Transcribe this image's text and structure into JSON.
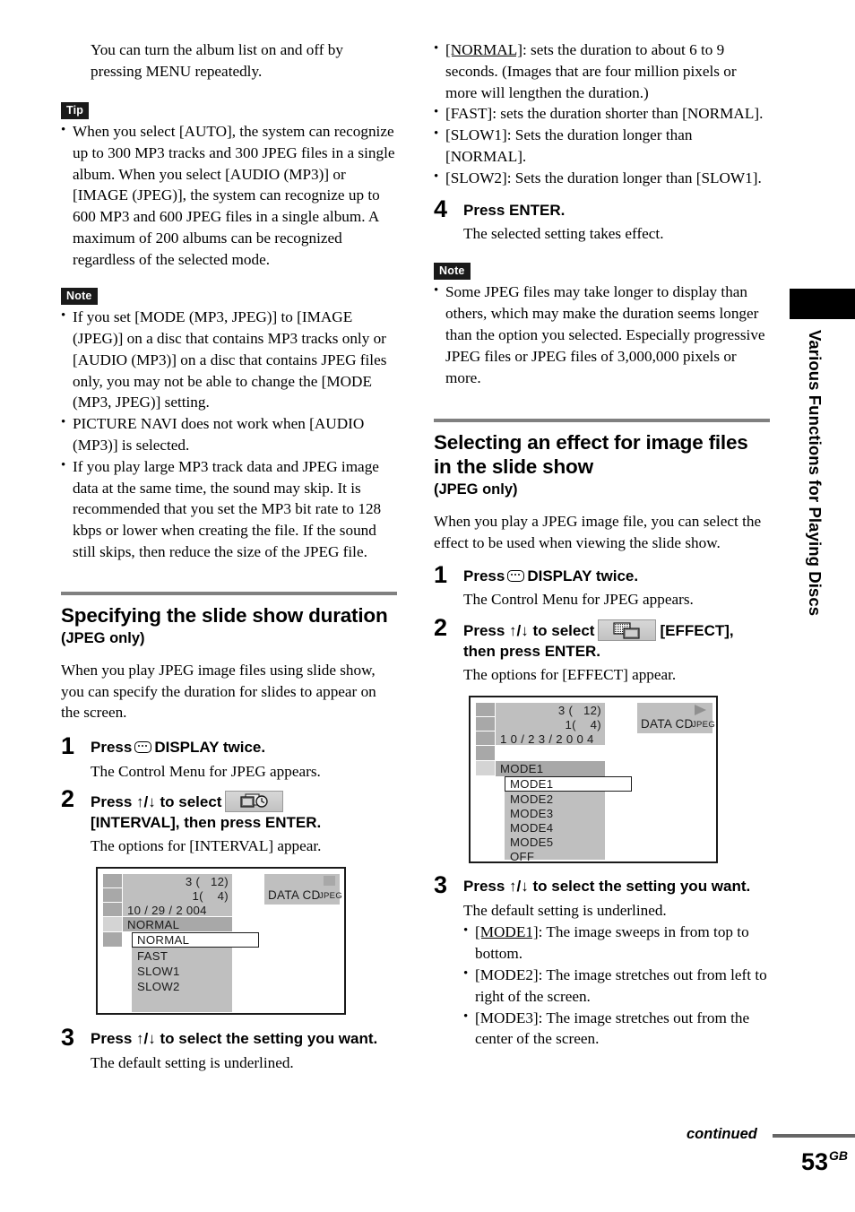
{
  "page": {
    "number": "53",
    "number_suffix": "GB",
    "continued_label": "continued",
    "side_tab_label": "Various Functions for Playing Discs"
  },
  "left_column": {
    "intro_paragraph": "You can turn the album list on and off by pressing MENU repeatedly.",
    "tip": {
      "badge": "Tip",
      "items": [
        "When you select [AUTO], the system can recognize up to 300 MP3 tracks and 300 JPEG files in a single album. When you select [AUDIO (MP3)] or [IMAGE (JPEG)], the system can recognize up to 600 MP3 and 600 JPEG files in a single album. A maximum of 200 albums can be recognized regardless of the selected mode."
      ]
    },
    "note": {
      "badge": "Note",
      "items": [
        "If you set [MODE (MP3, JPEG)] to [IMAGE (JPEG)] on a disc that contains MP3 tracks only or [AUDIO (MP3)] on a disc that contains JPEG files only, you may not be able to change the [MODE (MP3, JPEG)] setting.",
        "PICTURE NAVI does not work when [AUDIO (MP3)] is selected.",
        "If you play large MP3 track data and JPEG image data at the same time, the sound may skip. It is recommended that you set the MP3 bit rate to 128 kbps or lower when creating the file. If the sound still skips, then reduce the size of the JPEG file."
      ]
    },
    "section": {
      "title": "Specifying the slide show duration",
      "subtitle": "(JPEG only)",
      "intro": "When you play JPEG image files using slide show, you can specify the duration for slides to appear on the screen.",
      "steps": [
        {
          "number": "1",
          "heading_pre": "Press",
          "heading_post": "DISPLAY twice.",
          "icon": "display-icon",
          "body": "The Control Menu for JPEG appears."
        },
        {
          "number": "2",
          "heading_pre": "Press ↑/↓ to select",
          "heading_post": "[INTERVAL], then press ENTER.",
          "icon": "interval-icon",
          "body": "The options for [INTERVAL] appear."
        },
        {
          "number": "3",
          "heading": "Press ↑/↓ to select the setting you want.",
          "body": "The default setting is underlined."
        }
      ]
    },
    "tv_screen": {
      "track_line": "3 (   12)",
      "chapter_line": "1(    4)",
      "date_line": "10 / 29 / 2 004",
      "selected_value": "NORMAL",
      "disc_label": "DATA CD",
      "disc_format": "JPEG",
      "options": [
        "NORMAL",
        "FAST",
        "SLOW1",
        "SLOW2"
      ],
      "highlighted_option": "NORMAL"
    }
  },
  "right_column": {
    "interval_options": [
      {
        "name": "[NORMAL]",
        "underlined": true,
        "desc": ": sets the duration to about 6 to 9 seconds. (Images that are four million pixels or more will lengthen the duration.)"
      },
      {
        "name": "[FAST]",
        "underlined": false,
        "desc": ": sets the duration shorter than [NORMAL]."
      },
      {
        "name": "[SLOW1]",
        "underlined": false,
        "desc": ": Sets the duration longer than [NORMAL]."
      },
      {
        "name": "[SLOW2]",
        "underlined": false,
        "desc": ": Sets the duration longer than [SLOW1]."
      }
    ],
    "step4": {
      "number": "4",
      "heading": "Press ENTER.",
      "body": "The selected setting takes effect."
    },
    "note": {
      "badge": "Note",
      "items": [
        "Some JPEG files may take longer to display than others, which may make the duration seems longer than the option you selected. Especially progressive JPEG files or JPEG files of 3,000,000 pixels or more."
      ]
    },
    "section": {
      "title": "Selecting an effect for image files in the slide show",
      "subtitle": "(JPEG only)",
      "intro": "When you play a JPEG image file, you can select the effect to be used when viewing the slide show.",
      "steps": [
        {
          "number": "1",
          "heading_pre": "Press",
          "heading_post": "DISPLAY twice.",
          "icon": "display-icon",
          "body": "The Control Menu for JPEG appears."
        },
        {
          "number": "2",
          "heading_pre": "Press ↑/↓ to select",
          "heading_post": "[EFFECT], then press ENTER.",
          "icon": "effect-icon",
          "body": "The options for [EFFECT] appear."
        },
        {
          "number": "3",
          "heading": "Press ↑/↓ to select the setting you want.",
          "body": "The default setting is underlined."
        }
      ]
    },
    "tv_screen": {
      "track_line": "3 (   12)",
      "chapter_line": "1(    4)",
      "date_line": "1 0 / 2 3 / 2 0 0 4",
      "selected_value": "MODE1",
      "disc_label": "DATA CD",
      "disc_format": "JPEG",
      "play_icon": "play-triangle-icon",
      "options": [
        "MODE1",
        "MODE2",
        "MODE3",
        "MODE4",
        "MODE5",
        "OFF"
      ],
      "highlighted_option": "MODE1"
    },
    "effect_options": [
      {
        "name": "[MODE1]",
        "underlined": true,
        "desc": ": The image sweeps in from top to bottom."
      },
      {
        "name": "[MODE2]",
        "underlined": false,
        "desc": ": The image stretches out from left to right of the screen."
      },
      {
        "name": "[MODE3]",
        "underlined": false,
        "desc": ": The image stretches out from the center of the screen."
      }
    ]
  }
}
